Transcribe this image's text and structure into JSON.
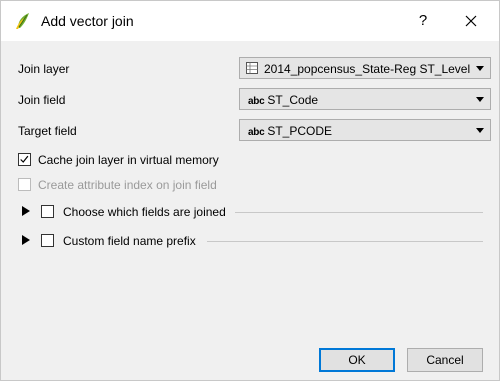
{
  "dialog": {
    "title": "Add vector join",
    "help_glyph": "?",
    "icon": "qgis-logo-icon"
  },
  "form": {
    "join_layer_label": "Join layer",
    "join_layer_value": "2014_popcensus_State-Reg ST_Level",
    "join_field_label": "Join field",
    "join_field_type": "abc",
    "join_field_value": "ST_Code",
    "target_field_label": "Target field",
    "target_field_type": "abc",
    "target_field_value": "ST_PCODE"
  },
  "options": {
    "cache_label": "Cache join layer in virtual memory",
    "cache_checked": true,
    "index_label": "Create attribute index on join field",
    "index_checked": false,
    "index_enabled": false
  },
  "groups": {
    "choose_fields_label": "Choose which fields are joined",
    "custom_prefix_label": "Custom field name prefix"
  },
  "buttons": {
    "ok_label": "OK",
    "cancel_label": "Cancel"
  },
  "colors": {
    "accent": "#0078d7",
    "qgis_green": "#6fae2e",
    "qgis_yellow": "#f2c313"
  }
}
